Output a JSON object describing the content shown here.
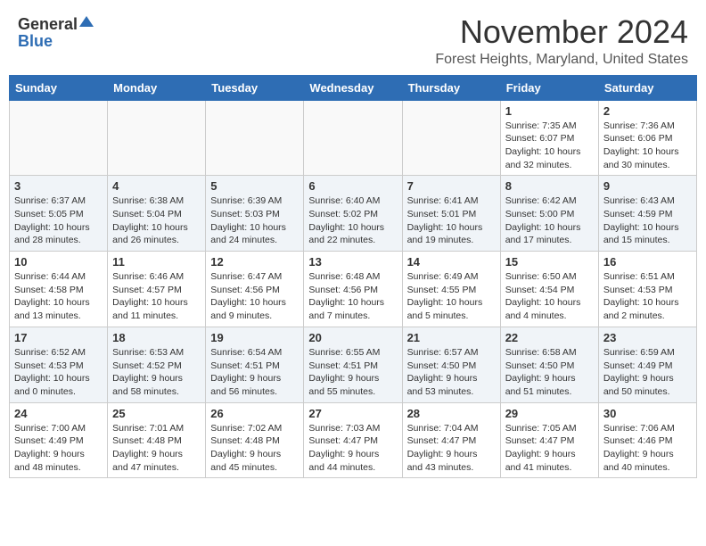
{
  "header": {
    "logo_general": "General",
    "logo_blue": "Blue",
    "month": "November 2024",
    "location": "Forest Heights, Maryland, United States"
  },
  "calendar": {
    "weekdays": [
      "Sunday",
      "Monday",
      "Tuesday",
      "Wednesday",
      "Thursday",
      "Friday",
      "Saturday"
    ],
    "weeks": [
      [
        {
          "day": "",
          "info": ""
        },
        {
          "day": "",
          "info": ""
        },
        {
          "day": "",
          "info": ""
        },
        {
          "day": "",
          "info": ""
        },
        {
          "day": "",
          "info": ""
        },
        {
          "day": "1",
          "info": "Sunrise: 7:35 AM\nSunset: 6:07 PM\nDaylight: 10 hours\nand 32 minutes."
        },
        {
          "day": "2",
          "info": "Sunrise: 7:36 AM\nSunset: 6:06 PM\nDaylight: 10 hours\nand 30 minutes."
        }
      ],
      [
        {
          "day": "3",
          "info": "Sunrise: 6:37 AM\nSunset: 5:05 PM\nDaylight: 10 hours\nand 28 minutes."
        },
        {
          "day": "4",
          "info": "Sunrise: 6:38 AM\nSunset: 5:04 PM\nDaylight: 10 hours\nand 26 minutes."
        },
        {
          "day": "5",
          "info": "Sunrise: 6:39 AM\nSunset: 5:03 PM\nDaylight: 10 hours\nand 24 minutes."
        },
        {
          "day": "6",
          "info": "Sunrise: 6:40 AM\nSunset: 5:02 PM\nDaylight: 10 hours\nand 22 minutes."
        },
        {
          "day": "7",
          "info": "Sunrise: 6:41 AM\nSunset: 5:01 PM\nDaylight: 10 hours\nand 19 minutes."
        },
        {
          "day": "8",
          "info": "Sunrise: 6:42 AM\nSunset: 5:00 PM\nDaylight: 10 hours\nand 17 minutes."
        },
        {
          "day": "9",
          "info": "Sunrise: 6:43 AM\nSunset: 4:59 PM\nDaylight: 10 hours\nand 15 minutes."
        }
      ],
      [
        {
          "day": "10",
          "info": "Sunrise: 6:44 AM\nSunset: 4:58 PM\nDaylight: 10 hours\nand 13 minutes."
        },
        {
          "day": "11",
          "info": "Sunrise: 6:46 AM\nSunset: 4:57 PM\nDaylight: 10 hours\nand 11 minutes."
        },
        {
          "day": "12",
          "info": "Sunrise: 6:47 AM\nSunset: 4:56 PM\nDaylight: 10 hours\nand 9 minutes."
        },
        {
          "day": "13",
          "info": "Sunrise: 6:48 AM\nSunset: 4:56 PM\nDaylight: 10 hours\nand 7 minutes."
        },
        {
          "day": "14",
          "info": "Sunrise: 6:49 AM\nSunset: 4:55 PM\nDaylight: 10 hours\nand 5 minutes."
        },
        {
          "day": "15",
          "info": "Sunrise: 6:50 AM\nSunset: 4:54 PM\nDaylight: 10 hours\nand 4 minutes."
        },
        {
          "day": "16",
          "info": "Sunrise: 6:51 AM\nSunset: 4:53 PM\nDaylight: 10 hours\nand 2 minutes."
        }
      ],
      [
        {
          "day": "17",
          "info": "Sunrise: 6:52 AM\nSunset: 4:53 PM\nDaylight: 10 hours\nand 0 minutes."
        },
        {
          "day": "18",
          "info": "Sunrise: 6:53 AM\nSunset: 4:52 PM\nDaylight: 9 hours\nand 58 minutes."
        },
        {
          "day": "19",
          "info": "Sunrise: 6:54 AM\nSunset: 4:51 PM\nDaylight: 9 hours\nand 56 minutes."
        },
        {
          "day": "20",
          "info": "Sunrise: 6:55 AM\nSunset: 4:51 PM\nDaylight: 9 hours\nand 55 minutes."
        },
        {
          "day": "21",
          "info": "Sunrise: 6:57 AM\nSunset: 4:50 PM\nDaylight: 9 hours\nand 53 minutes."
        },
        {
          "day": "22",
          "info": "Sunrise: 6:58 AM\nSunset: 4:50 PM\nDaylight: 9 hours\nand 51 minutes."
        },
        {
          "day": "23",
          "info": "Sunrise: 6:59 AM\nSunset: 4:49 PM\nDaylight: 9 hours\nand 50 minutes."
        }
      ],
      [
        {
          "day": "24",
          "info": "Sunrise: 7:00 AM\nSunset: 4:49 PM\nDaylight: 9 hours\nand 48 minutes."
        },
        {
          "day": "25",
          "info": "Sunrise: 7:01 AM\nSunset: 4:48 PM\nDaylight: 9 hours\nand 47 minutes."
        },
        {
          "day": "26",
          "info": "Sunrise: 7:02 AM\nSunset: 4:48 PM\nDaylight: 9 hours\nand 45 minutes."
        },
        {
          "day": "27",
          "info": "Sunrise: 7:03 AM\nSunset: 4:47 PM\nDaylight: 9 hours\nand 44 minutes."
        },
        {
          "day": "28",
          "info": "Sunrise: 7:04 AM\nSunset: 4:47 PM\nDaylight: 9 hours\nand 43 minutes."
        },
        {
          "day": "29",
          "info": "Sunrise: 7:05 AM\nSunset: 4:47 PM\nDaylight: 9 hours\nand 41 minutes."
        },
        {
          "day": "30",
          "info": "Sunrise: 7:06 AM\nSunset: 4:46 PM\nDaylight: 9 hours\nand 40 minutes."
        }
      ]
    ]
  }
}
